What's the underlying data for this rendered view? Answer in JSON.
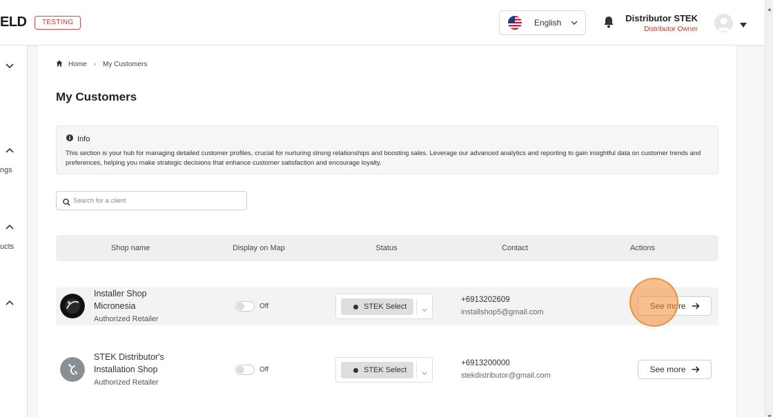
{
  "header": {
    "logo_text": "ELD",
    "env_badge": "TESTING",
    "language": "English",
    "user_name": "Distributor STEK",
    "user_role": "Distributor Owner"
  },
  "sidebar": {
    "labels": [
      "ngs",
      "ucts"
    ]
  },
  "breadcrumb": {
    "home": "Home",
    "current": "My Customers"
  },
  "page": {
    "title": "My Customers"
  },
  "info": {
    "title": "Info",
    "body": "This section is your hub for managing detailed customer profiles, crucial for nurturing strong relationships and boosting sales. Leverage our advanced analytics and reporting to gain insightful data on customer trends and preferences, helping you make strategic decisions that enhance customer satisfaction and encourage loyalty."
  },
  "search": {
    "placeholder": "Search for a client"
  },
  "table": {
    "columns": [
      "Shop name",
      "Display on Map",
      "Status",
      "Contact",
      "Actions"
    ],
    "rows": [
      {
        "name_line1": "Installer Shop",
        "name_line2": "Micronesia",
        "type": "Authorized Retailer",
        "map_toggle": "Off",
        "status": "STEK Select",
        "phone": "+6913202609",
        "email": "installshop5@gmail.com",
        "action": "See more"
      },
      {
        "name_line1": "STEK Distributor's",
        "name_line2": "Installation Shop",
        "type": "Authorized Retailer",
        "map_toggle": "Off",
        "status": "STEK Select",
        "phone": "+6913200000",
        "email": "stekdistributor@gmail.com",
        "action": "See more"
      }
    ]
  },
  "colors": {
    "accent_red": "#c0392b",
    "click_marker": "#f08c32"
  }
}
